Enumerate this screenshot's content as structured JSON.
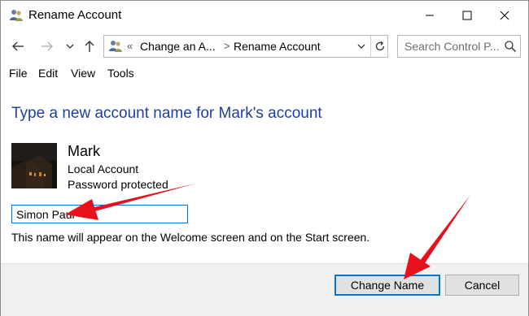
{
  "window": {
    "title": "Rename Account"
  },
  "address": {
    "overflow_chevron": "«",
    "segments": [
      "Change an A...",
      "Rename Account"
    ],
    "separator": ">"
  },
  "search": {
    "placeholder": "Search Control P..."
  },
  "menu": {
    "items": [
      "File",
      "Edit",
      "View",
      "Tools"
    ]
  },
  "main": {
    "heading": "Type a new account name for Mark's account",
    "account": {
      "name": "Mark",
      "type": "Local Account",
      "protection": "Password protected"
    },
    "new_name_value": "Simon Paul",
    "hint": "This name will appear on the Welcome screen and on the Start screen."
  },
  "buttons": {
    "change_name": "Change Name",
    "cancel": "Cancel"
  },
  "icons": [
    "users-icon",
    "back-arrow-icon",
    "forward-arrow-icon",
    "chevron-down-icon",
    "up-arrow-icon",
    "refresh-icon",
    "search-icon",
    "minimize-icon",
    "maximize-icon",
    "close-icon"
  ],
  "colors": {
    "heading": "#1e3f9e",
    "focus_border": "#0078d7",
    "annotation_arrow": "#e8101a"
  }
}
